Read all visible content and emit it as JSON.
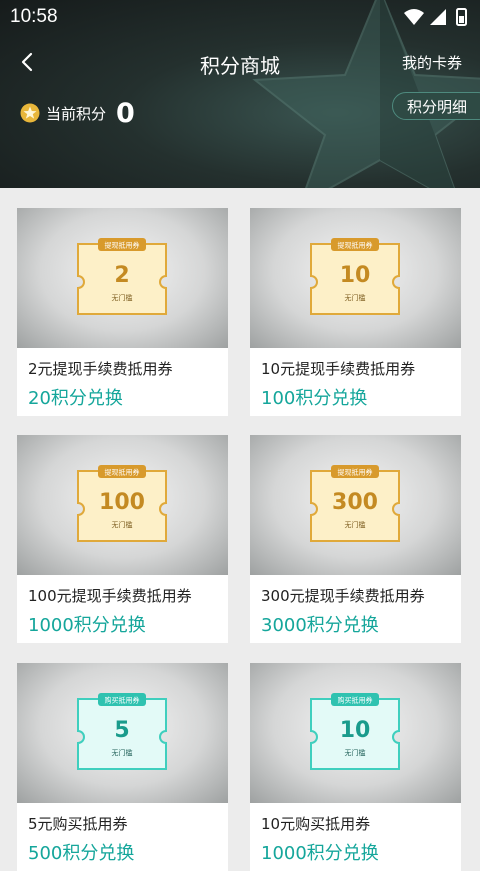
{
  "status_bar": {
    "time": "10:58"
  },
  "nav": {
    "title": "积分商城",
    "my_cards": "我的卡券"
  },
  "points": {
    "label": "当前积分",
    "value": "0"
  },
  "detail_button": "积分明细",
  "colors": {
    "accent": "#15a69b",
    "header_dark": "#1e2826"
  },
  "coupons": [
    {
      "tag": "提现抵用券",
      "amount": "2",
      "sub": "无门槛",
      "style": "gold",
      "name": "2元提现手续费抵用券",
      "price": "20积分兑换"
    },
    {
      "tag": "提现抵用券",
      "amount": "10",
      "sub": "无门槛",
      "style": "gold",
      "name": "10元提现手续费抵用券",
      "price": "100积分兑换"
    },
    {
      "tag": "提现抵用券",
      "amount": "100",
      "sub": "无门槛",
      "style": "gold",
      "name": "100元提现手续费抵用券",
      "price": "1000积分兑换"
    },
    {
      "tag": "提现抵用券",
      "amount": "300",
      "sub": "无门槛",
      "style": "gold",
      "name": "300元提现手续费抵用券",
      "price": "3000积分兑换"
    },
    {
      "tag": "购买抵用券",
      "amount": "5",
      "sub": "无门槛",
      "style": "teal",
      "name": "5元购买抵用券",
      "price": "500积分兑换"
    },
    {
      "tag": "购买抵用券",
      "amount": "10",
      "sub": "无门槛",
      "style": "teal",
      "name": "10元购买抵用券",
      "price": "1000积分兑换"
    }
  ]
}
